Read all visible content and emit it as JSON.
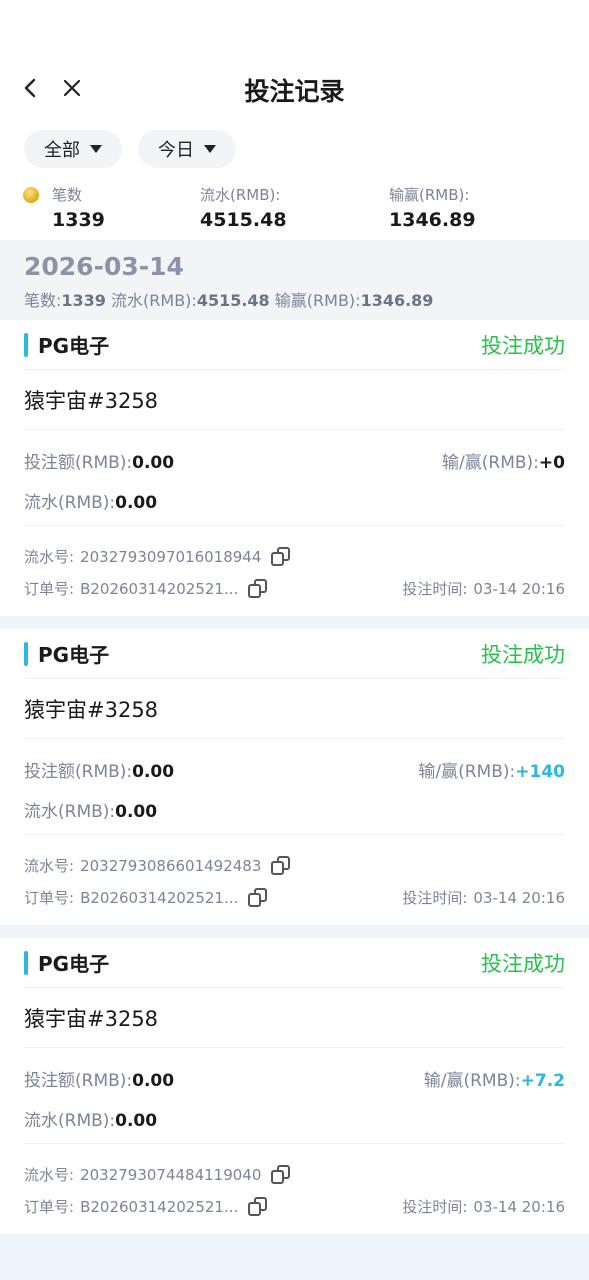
{
  "nav": {
    "title": "投注记录",
    "back_icon": "chevron-left-icon",
    "close_icon": "close-icon"
  },
  "filters": [
    {
      "label": "全部"
    },
    {
      "label": "今日"
    }
  ],
  "stats": {
    "count_label": "笔数",
    "count_value": "1339",
    "turnover_label": "流水(RMB):",
    "turnover_value": "4515.48",
    "winloss_label": "输赢(RMB):",
    "winloss_value": "1346.89"
  },
  "day": {
    "date": "2026-03-14",
    "count_label": "笔数:",
    "count": "1339",
    "turnover_label": " 流水(RMB):",
    "turnover": "4515.48",
    "winloss_label": " 输赢(RMB):",
    "winloss": "1346.89"
  },
  "records": [
    {
      "provider": "PG电子",
      "status": "投注成功",
      "game": "猿宇宙#3258",
      "bet_label": "投注额(RMB):",
      "bet": "0.00",
      "winloss_label": "输/赢(RMB):",
      "winloss": "+0",
      "turnover_label": "流水(RMB):",
      "turnover": "0.00",
      "serial_label": "流水号:",
      "serial": "2032793097016018944",
      "order_label": "订单号:",
      "order": "B20260314202521...",
      "time_label": "投注时间:",
      "time": "03-14 20:16"
    },
    {
      "provider": "PG电子",
      "status": "投注成功",
      "game": "猿宇宙#3258",
      "bet_label": "投注额(RMB):",
      "bet": "0.00",
      "winloss_label": "输/赢(RMB):",
      "winloss": "+140",
      "turnover_label": "流水(RMB):",
      "turnover": "0.00",
      "serial_label": "流水号:",
      "serial": "2032793086601492483",
      "order_label": "订单号:",
      "order": "B20260314202521...",
      "time_label": "投注时间:",
      "time": "03-14 20:16"
    },
    {
      "provider": "PG电子",
      "status": "投注成功",
      "game": "猿宇宙#3258",
      "bet_label": "投注额(RMB):",
      "bet": "0.00",
      "winloss_label": "输/赢(RMB):",
      "winloss": "+7.2",
      "turnover_label": "流水(RMB):",
      "turnover": "0.00",
      "serial_label": "流水号:",
      "serial": "2032793074484119040",
      "order_label": "订单号:",
      "order": "B20260314202521...",
      "time_label": "投注时间:",
      "time": "03-14 20:16"
    }
  ],
  "colors": {
    "accent": "#2bb6e3",
    "success": "#27c24c",
    "muted": "#7b8599"
  }
}
